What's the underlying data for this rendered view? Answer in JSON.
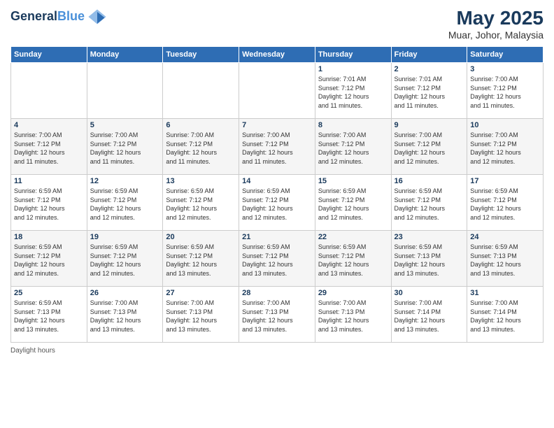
{
  "header": {
    "logo_line1": "General",
    "logo_line2": "Blue",
    "main_title": "May 2025",
    "subtitle": "Muar, Johor, Malaysia"
  },
  "days_of_week": [
    "Sunday",
    "Monday",
    "Tuesday",
    "Wednesday",
    "Thursday",
    "Friday",
    "Saturday"
  ],
  "weeks": [
    [
      {
        "day": "",
        "info": ""
      },
      {
        "day": "",
        "info": ""
      },
      {
        "day": "",
        "info": ""
      },
      {
        "day": "",
        "info": ""
      },
      {
        "day": "1",
        "info": "Sunrise: 7:01 AM\nSunset: 7:12 PM\nDaylight: 12 hours\nand 11 minutes."
      },
      {
        "day": "2",
        "info": "Sunrise: 7:01 AM\nSunset: 7:12 PM\nDaylight: 12 hours\nand 11 minutes."
      },
      {
        "day": "3",
        "info": "Sunrise: 7:00 AM\nSunset: 7:12 PM\nDaylight: 12 hours\nand 11 minutes."
      }
    ],
    [
      {
        "day": "4",
        "info": "Sunrise: 7:00 AM\nSunset: 7:12 PM\nDaylight: 12 hours\nand 11 minutes."
      },
      {
        "day": "5",
        "info": "Sunrise: 7:00 AM\nSunset: 7:12 PM\nDaylight: 12 hours\nand 11 minutes."
      },
      {
        "day": "6",
        "info": "Sunrise: 7:00 AM\nSunset: 7:12 PM\nDaylight: 12 hours\nand 11 minutes."
      },
      {
        "day": "7",
        "info": "Sunrise: 7:00 AM\nSunset: 7:12 PM\nDaylight: 12 hours\nand 11 minutes."
      },
      {
        "day": "8",
        "info": "Sunrise: 7:00 AM\nSunset: 7:12 PM\nDaylight: 12 hours\nand 12 minutes."
      },
      {
        "day": "9",
        "info": "Sunrise: 7:00 AM\nSunset: 7:12 PM\nDaylight: 12 hours\nand 12 minutes."
      },
      {
        "day": "10",
        "info": "Sunrise: 7:00 AM\nSunset: 7:12 PM\nDaylight: 12 hours\nand 12 minutes."
      }
    ],
    [
      {
        "day": "11",
        "info": "Sunrise: 6:59 AM\nSunset: 7:12 PM\nDaylight: 12 hours\nand 12 minutes."
      },
      {
        "day": "12",
        "info": "Sunrise: 6:59 AM\nSunset: 7:12 PM\nDaylight: 12 hours\nand 12 minutes."
      },
      {
        "day": "13",
        "info": "Sunrise: 6:59 AM\nSunset: 7:12 PM\nDaylight: 12 hours\nand 12 minutes."
      },
      {
        "day": "14",
        "info": "Sunrise: 6:59 AM\nSunset: 7:12 PM\nDaylight: 12 hours\nand 12 minutes."
      },
      {
        "day": "15",
        "info": "Sunrise: 6:59 AM\nSunset: 7:12 PM\nDaylight: 12 hours\nand 12 minutes."
      },
      {
        "day": "16",
        "info": "Sunrise: 6:59 AM\nSunset: 7:12 PM\nDaylight: 12 hours\nand 12 minutes."
      },
      {
        "day": "17",
        "info": "Sunrise: 6:59 AM\nSunset: 7:12 PM\nDaylight: 12 hours\nand 12 minutes."
      }
    ],
    [
      {
        "day": "18",
        "info": "Sunrise: 6:59 AM\nSunset: 7:12 PM\nDaylight: 12 hours\nand 12 minutes."
      },
      {
        "day": "19",
        "info": "Sunrise: 6:59 AM\nSunset: 7:12 PM\nDaylight: 12 hours\nand 12 minutes."
      },
      {
        "day": "20",
        "info": "Sunrise: 6:59 AM\nSunset: 7:12 PM\nDaylight: 12 hours\nand 13 minutes."
      },
      {
        "day": "21",
        "info": "Sunrise: 6:59 AM\nSunset: 7:12 PM\nDaylight: 12 hours\nand 13 minutes."
      },
      {
        "day": "22",
        "info": "Sunrise: 6:59 AM\nSunset: 7:12 PM\nDaylight: 12 hours\nand 13 minutes."
      },
      {
        "day": "23",
        "info": "Sunrise: 6:59 AM\nSunset: 7:13 PM\nDaylight: 12 hours\nand 13 minutes."
      },
      {
        "day": "24",
        "info": "Sunrise: 6:59 AM\nSunset: 7:13 PM\nDaylight: 12 hours\nand 13 minutes."
      }
    ],
    [
      {
        "day": "25",
        "info": "Sunrise: 6:59 AM\nSunset: 7:13 PM\nDaylight: 12 hours\nand 13 minutes."
      },
      {
        "day": "26",
        "info": "Sunrise: 7:00 AM\nSunset: 7:13 PM\nDaylight: 12 hours\nand 13 minutes."
      },
      {
        "day": "27",
        "info": "Sunrise: 7:00 AM\nSunset: 7:13 PM\nDaylight: 12 hours\nand 13 minutes."
      },
      {
        "day": "28",
        "info": "Sunrise: 7:00 AM\nSunset: 7:13 PM\nDaylight: 12 hours\nand 13 minutes."
      },
      {
        "day": "29",
        "info": "Sunrise: 7:00 AM\nSunset: 7:13 PM\nDaylight: 12 hours\nand 13 minutes."
      },
      {
        "day": "30",
        "info": "Sunrise: 7:00 AM\nSunset: 7:14 PM\nDaylight: 12 hours\nand 13 minutes."
      },
      {
        "day": "31",
        "info": "Sunrise: 7:00 AM\nSunset: 7:14 PM\nDaylight: 12 hours\nand 13 minutes."
      }
    ]
  ],
  "footer": {
    "note": "Daylight hours"
  }
}
